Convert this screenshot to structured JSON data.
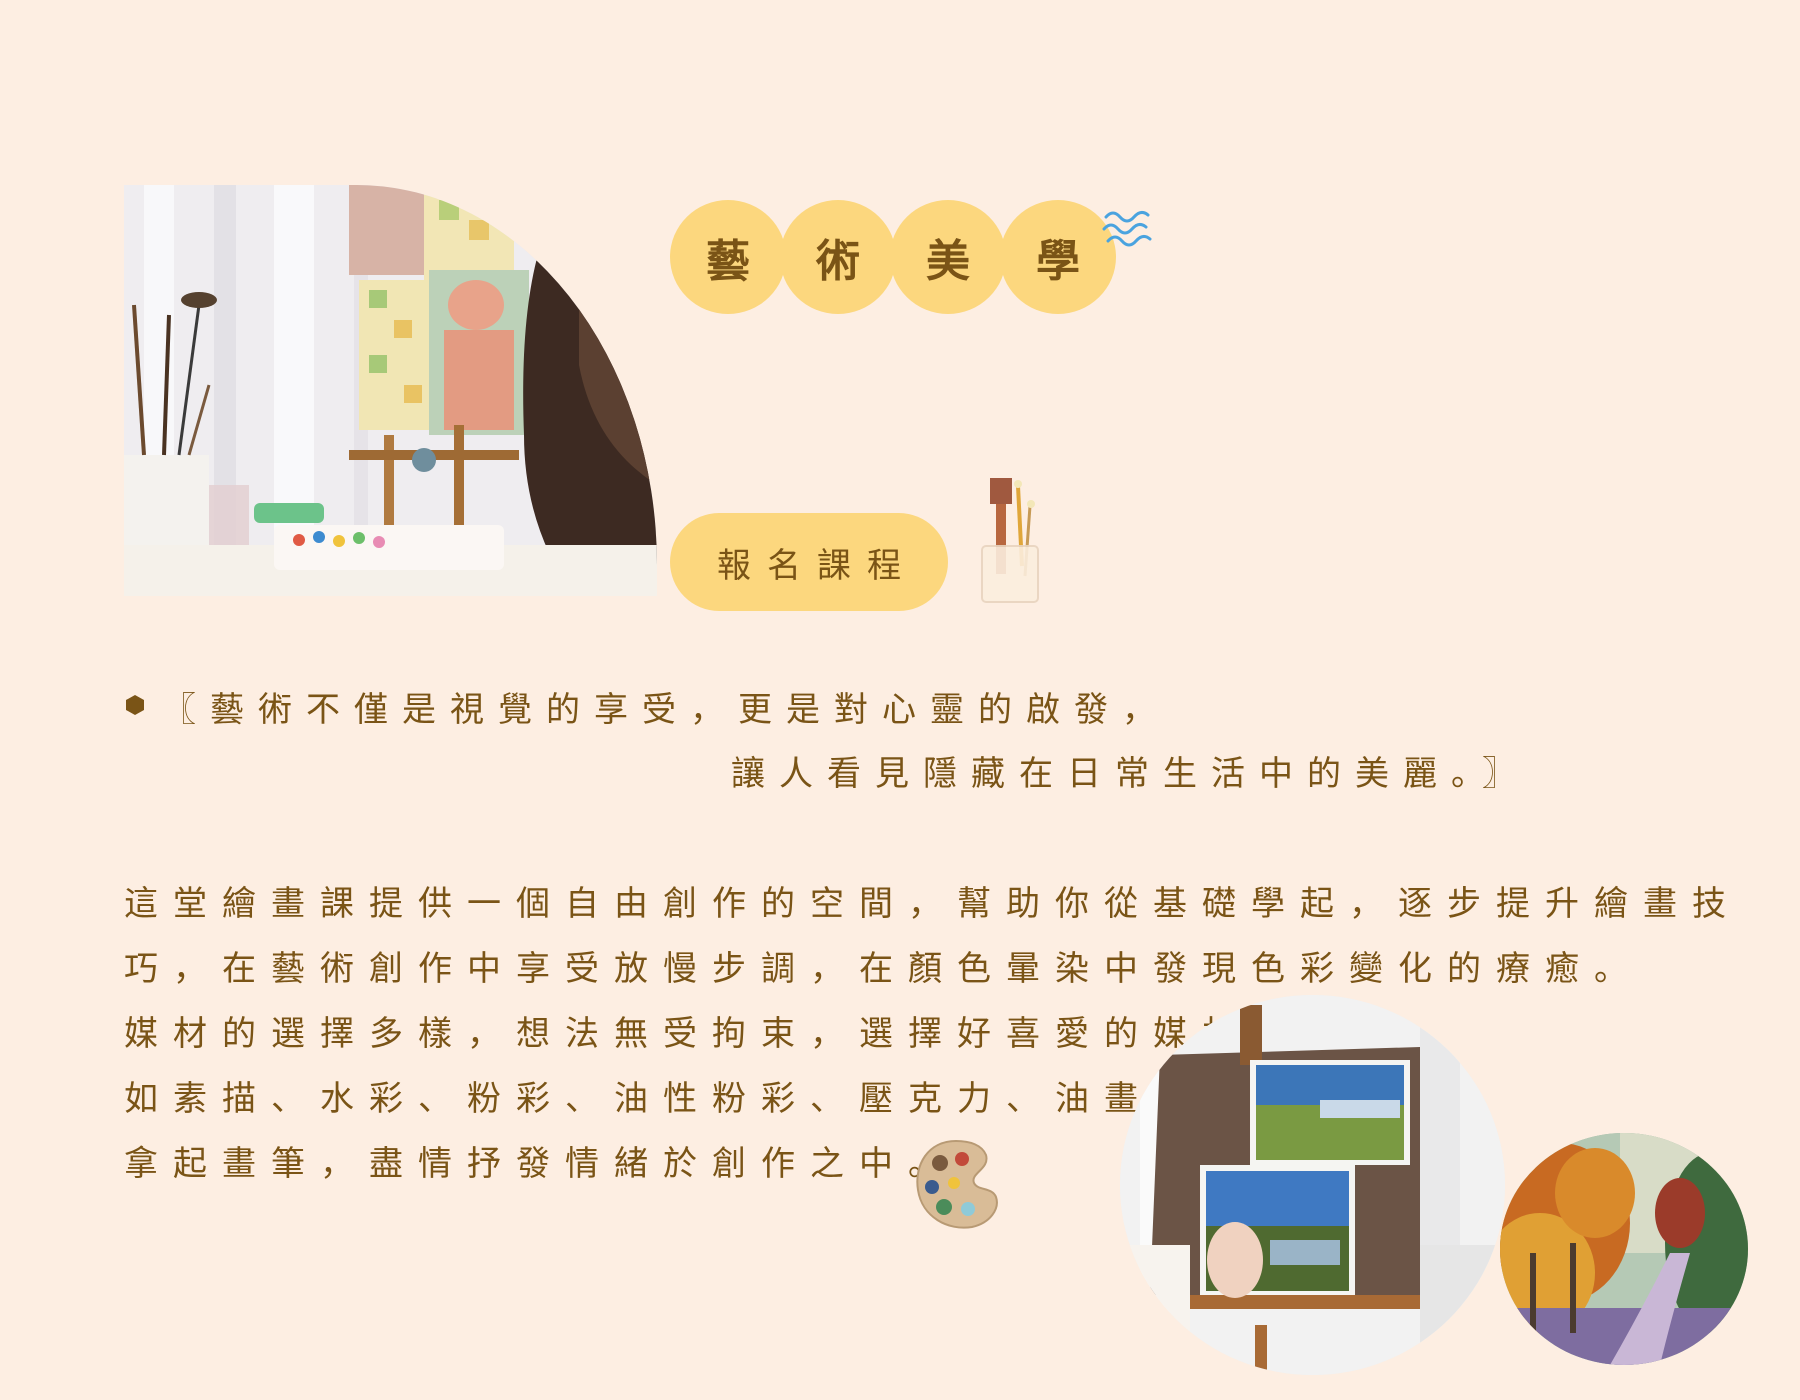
{
  "title": {
    "chars": [
      "藝",
      "術",
      "美",
      "學"
    ]
  },
  "enroll": {
    "label": "報名課程"
  },
  "quote": {
    "line1": "〖藝術不僅是視覺的享受，更是對心靈的啟發，",
    "line2": "讓人看見隱藏在日常生活中的美麗。〗"
  },
  "body": {
    "line1": "這堂繪畫課提供一個自由創作的空間，幫助你從基礎學起，逐步提升繪畫技",
    "line2": "巧，在藝術創作中享受放慢步調，在顏色暈染中發現色彩變化的療癒。",
    "line3": "媒材的選擇多樣，想法無受拘束，選擇好喜愛的媒材，",
    "line4": "如素描、水彩、粉彩、油性粉彩、壓克力、油畫，",
    "line5": "拿起畫筆，盡情抒發情緒於創作之中。"
  },
  "colors": {
    "background": "#fdeee2",
    "accent": "#fcd77e",
    "text": "#7a5416"
  },
  "icons": {
    "waves": "waves-icon",
    "brush_jar": "brush-jar-icon",
    "palette": "palette-icon",
    "bullet": "hexagon-bullet-icon"
  }
}
